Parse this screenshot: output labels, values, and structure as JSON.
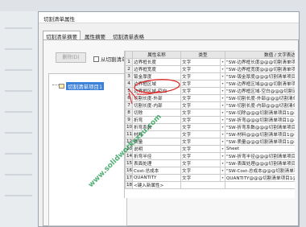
{
  "window": {
    "title": "切割清单属性"
  },
  "tabs": [
    {
      "label": "切割清单摘要",
      "active": true
    },
    {
      "label": "属性摘要",
      "active": false
    },
    {
      "label": "切割清单表格",
      "active": false
    }
  ],
  "toolbar": {
    "delete_label": "删除(D)",
    "checkbox_label": "从切割清单中排除(E)"
  },
  "tree": {
    "item_label": "切割清单项目1"
  },
  "table": {
    "headers": [
      "",
      "属性名称",
      "类型",
      "数值 / 文字表达"
    ],
    "rows": [
      {
        "n": "1",
        "name": "边界框长度",
        "type": "文字",
        "value": "\"SW-边界框长度@@@切割清单项"
      },
      {
        "n": "2",
        "name": "边界框宽度",
        "type": "文字",
        "value": "\"SW-边界框宽度@@@切割清单项"
      },
      {
        "n": "3",
        "name": "钣金厚度",
        "type": "文字",
        "value": "\"SW-钣金厚度@@@切割清单项目"
      },
      {
        "n": "4",
        "name": "边界框区域",
        "type": "文字",
        "value": "\"SW-边界框区域@@@切割清单项"
      },
      {
        "n": "5",
        "name": "边界框区域-空白",
        "type": "文字",
        "value": "\"SW-边界框区域-空白@@@切割清"
      },
      {
        "n": "6",
        "name": "切割长度-外部",
        "type": "文字",
        "value": "\"SW-切割长度-外部@@@切割清单"
      },
      {
        "n": "7",
        "name": "切割长度-内部",
        "type": "文字",
        "value": "\"SW-切割长度-内部@@@切割清单"
      },
      {
        "n": "8",
        "name": "切除",
        "type": "文字",
        "value": "\"SW-切除@@@切割清单项目1@手"
      },
      {
        "n": "9",
        "name": "折弯",
        "type": "文字",
        "value": "\"SW-折弯@@@切割清单项目1@手"
      },
      {
        "n": "10",
        "name": "折弯系数",
        "type": "文字",
        "value": "\"SW-折弯系数@@@切割清单项目1"
      },
      {
        "n": "11",
        "name": "材料",
        "type": "文字",
        "value": "\"SW-材料@@@切割清单项目1@手"
      },
      {
        "n": "12",
        "name": "质量",
        "type": "文字",
        "value": "\"SW-质量@@@切割清单项目1@手"
      },
      {
        "n": "13",
        "name": "说明",
        "type": "文字",
        "value": "Sheet"
      },
      {
        "n": "14",
        "name": "折弯半径",
        "type": "文字",
        "value": "\"SW-折弯半径@@@切割清单项目1"
      },
      {
        "n": "15",
        "name": "表面处理",
        "type": "文字",
        "value": "\"SW-表面处理@@@切割清单项目1"
      },
      {
        "n": "16",
        "name": "Cost-总成本",
        "type": "文字",
        "value": "\"SW-Cost-总成本@@@切割清单项目"
      },
      {
        "n": "17",
        "name": "QUANTITY",
        "type": "文字",
        "value": "QUANTITY@@@切割清单项目1@"
      },
      {
        "n": "18",
        "name": "<键入新属性>",
        "type": "",
        "value": ""
      }
    ]
  },
  "watermark": {
    "text": "www.solidworksxzu.com"
  },
  "colors": {
    "accent": "#3d80d8",
    "annotation": "#e02020",
    "watermark": "#1e9646"
  }
}
